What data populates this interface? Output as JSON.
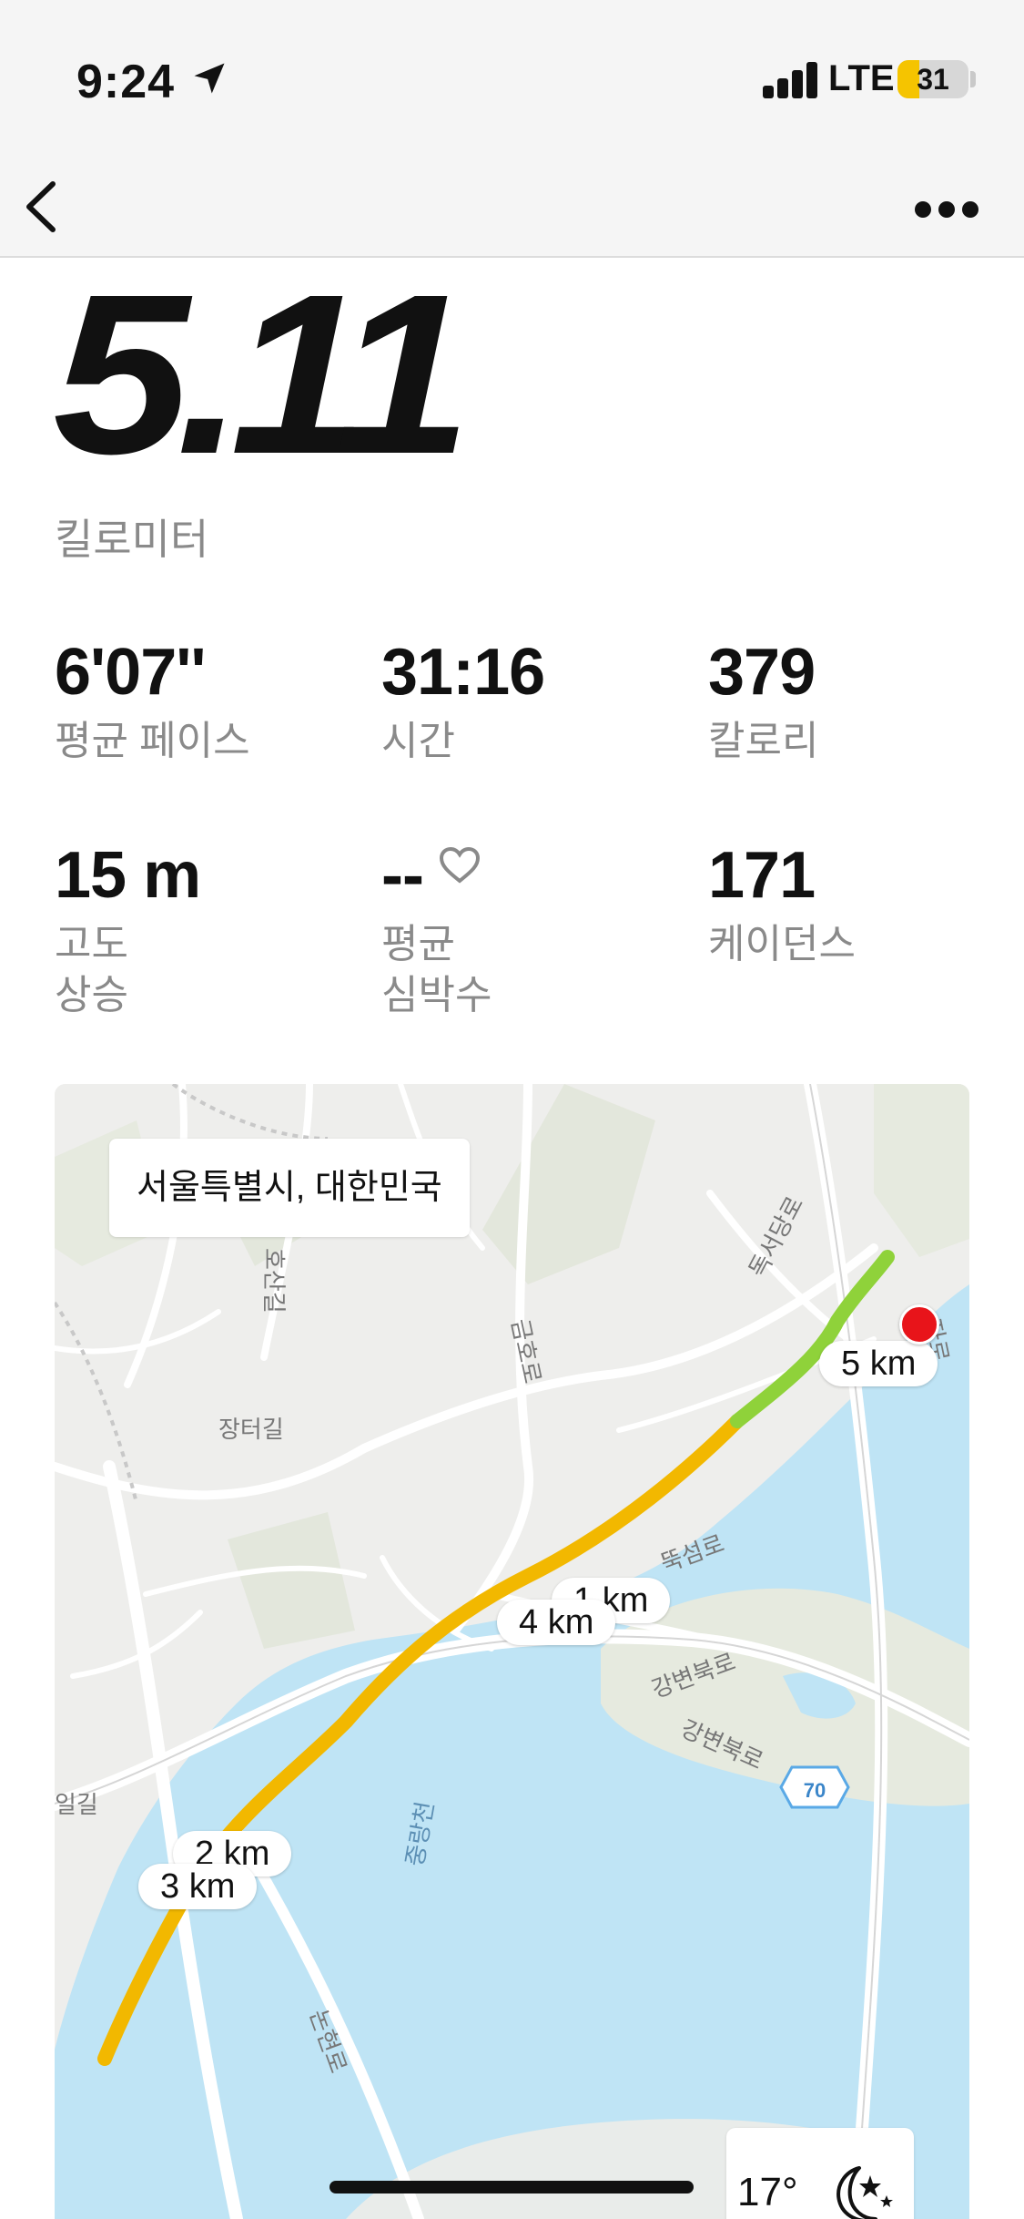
{
  "status_bar": {
    "time": "9:24",
    "network": "LTE",
    "battery_level": "31",
    "battery_fraction": 0.31,
    "battery_color": "#f5c400"
  },
  "nav": {
    "back_icon": "chevron-left-icon",
    "more_icon": "ellipsis-icon"
  },
  "summary": {
    "distance": "5.11",
    "distance_unit": "킬로미터"
  },
  "stats": [
    {
      "value": "6'07''",
      "label": "평균 페이스"
    },
    {
      "value": "31:16",
      "label": "시간"
    },
    {
      "value": "379",
      "label": "칼로리"
    },
    {
      "value": "15 m",
      "label": "고도\n상승"
    },
    {
      "value": "--",
      "label": "평균\n심박수",
      "icon": "heart-icon"
    },
    {
      "value": "171",
      "label": "케이던스"
    }
  ],
  "map": {
    "location": "서울특별시, 대한민국",
    "road_labels": [
      "장터길",
      "금호로",
      "독서당로",
      "뚝섬로",
      "강변북로",
      "강변북로",
      "중랑천",
      "논현로",
      "자로",
      "호산길",
      "일길"
    ],
    "highway_shield": "70",
    "km_markers": [
      "1 km",
      "2 km",
      "3 km",
      "4 km",
      "5 km"
    ],
    "route_colors": {
      "slow": "#f2b800",
      "fast": "#8fd23a"
    },
    "end_pin_color": "#e8141a",
    "water_color": "#bfe4f5",
    "weather": {
      "temperature": "17°",
      "icon": "moon-stars-icon"
    }
  }
}
